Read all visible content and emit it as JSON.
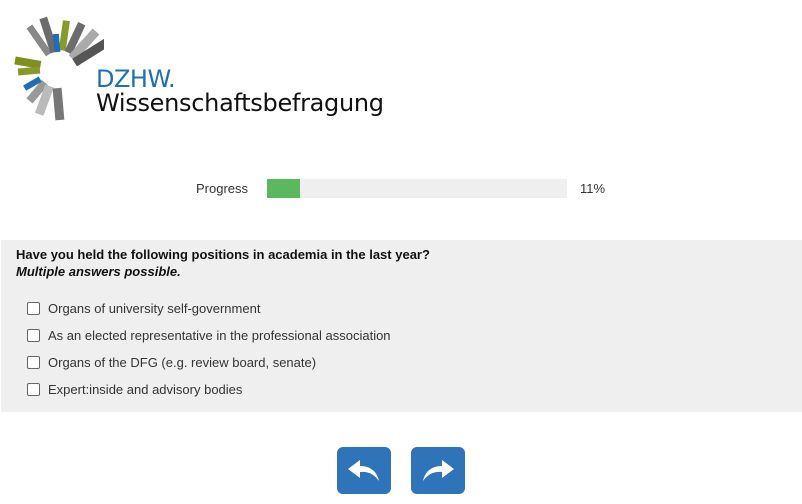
{
  "logo": {
    "brand": "DZHW.",
    "title": "Wissenschaftsbefragung"
  },
  "progress": {
    "label": "Progress",
    "value_text": "11%",
    "value": 0.11,
    "fill_color": "#5cb85c"
  },
  "question": {
    "title": "Have you held the following positions in academia in the last year?",
    "note": "Multiple answers possible.",
    "options": [
      {
        "label": "Organs of university self-government",
        "checked": false
      },
      {
        "label": "As an elected representative in the professional association",
        "checked": false
      },
      {
        "label": "Organs of the DFG (e.g. review board, senate)",
        "checked": false
      },
      {
        "label": "Expert:inside and advisory bodies",
        "checked": false
      }
    ]
  },
  "navigation": {
    "back_icon": "back-arrow-icon",
    "next_icon": "forward-arrow-icon",
    "button_color": "#2f74b9"
  }
}
